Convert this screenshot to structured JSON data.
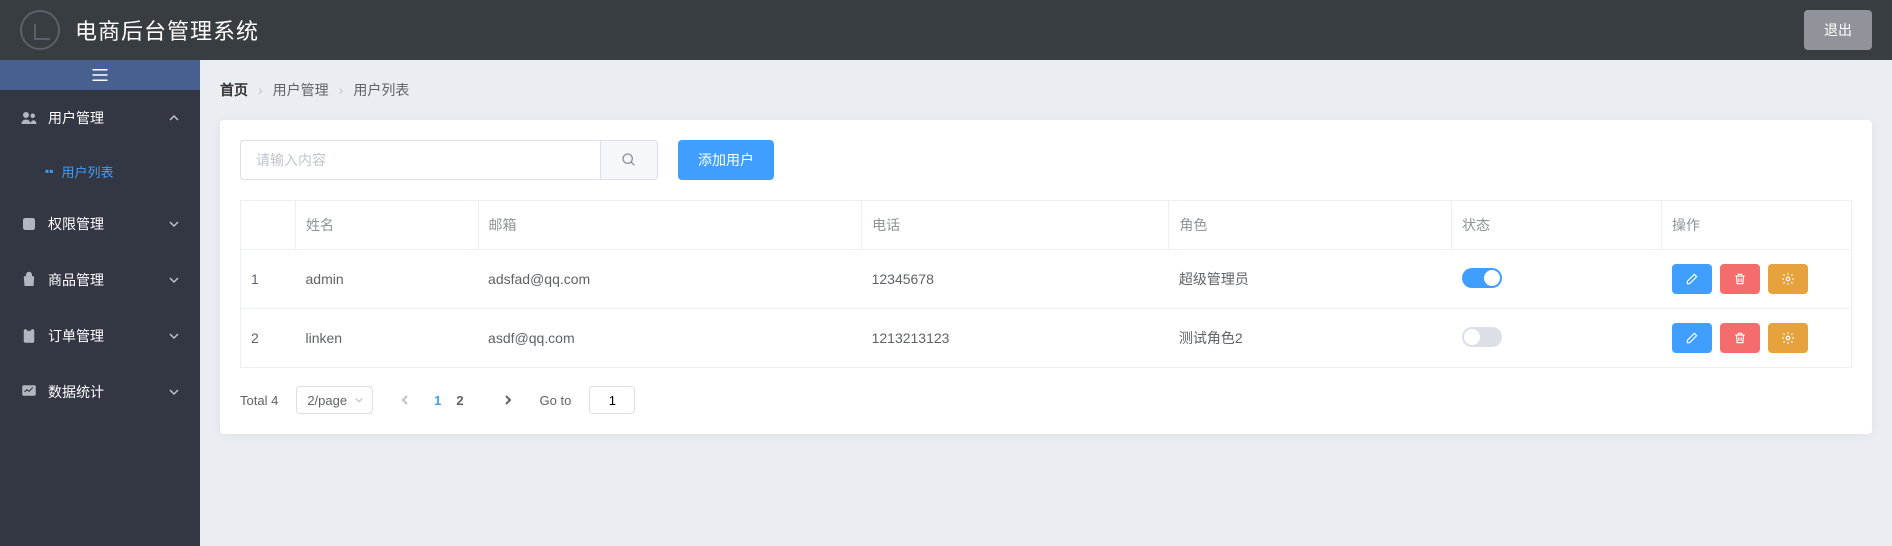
{
  "header": {
    "title": "电商后台管理系统",
    "logout": "退出"
  },
  "sidebar": {
    "items": [
      {
        "label": "用户管理",
        "icon": "users"
      },
      {
        "label": "权限管理",
        "icon": "key"
      },
      {
        "label": "商品管理",
        "icon": "goods"
      },
      {
        "label": "订单管理",
        "icon": "order"
      },
      {
        "label": "数据统计",
        "icon": "chart"
      }
    ],
    "submenu_label": "用户列表"
  },
  "breadcrumb": {
    "home": "首页",
    "group": "用户管理",
    "page": "用户列表"
  },
  "toolbar": {
    "search_placeholder": "请输入内容",
    "add_label": "添加用户"
  },
  "table": {
    "headers": {
      "index": "",
      "name": "姓名",
      "email": "邮箱",
      "phone": "电话",
      "role": "角色",
      "status": "状态",
      "actions": "操作"
    },
    "rows": [
      {
        "index": "1",
        "name": "admin",
        "email": "adsfad@qq.com",
        "phone": "12345678",
        "role": "超级管理员",
        "status": true
      },
      {
        "index": "2",
        "name": "linken",
        "email": "asdf@qq.com",
        "phone": "1213213123",
        "role": "测试角色2",
        "status": false
      }
    ]
  },
  "pagination": {
    "total_label": "Total 4",
    "page_size": "2/page",
    "pages": [
      "1",
      "2"
    ],
    "active_page": "1",
    "goto_label": "Go to",
    "goto_value": "1"
  }
}
